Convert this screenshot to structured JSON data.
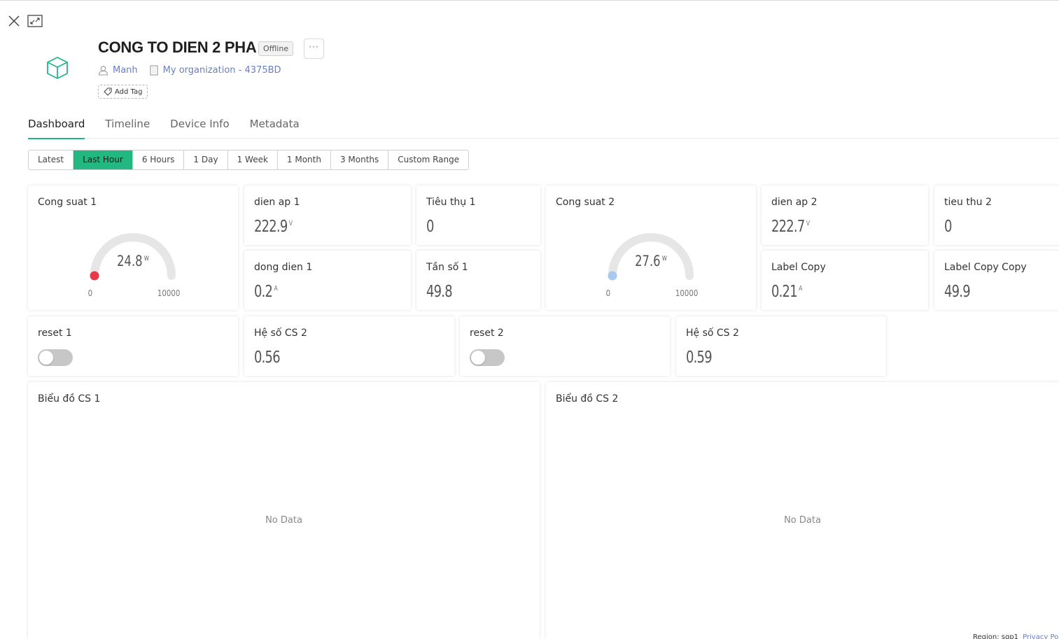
{
  "device": {
    "title": "CONG TO DIEN 2 PHA",
    "status": "Offline",
    "owner": "Manh",
    "organization": "My organization - 4375BD",
    "add_tag": "Add Tag",
    "more": "···"
  },
  "tabs": [
    {
      "label": "Dashboard",
      "active": true
    },
    {
      "label": "Timeline",
      "active": false
    },
    {
      "label": "Device Info",
      "active": false
    },
    {
      "label": "Metadata",
      "active": false
    }
  ],
  "time_ranges": [
    {
      "label": "Latest",
      "active": false
    },
    {
      "label": "Last Hour",
      "active": true
    },
    {
      "label": "6 Hours",
      "active": false
    },
    {
      "label": "1 Day",
      "active": false
    },
    {
      "label": "1 Week",
      "active": false
    },
    {
      "label": "1 Month",
      "active": false
    },
    {
      "label": "3 Months",
      "active": false
    },
    {
      "label": "Custom Range",
      "active": false
    }
  ],
  "widgets": {
    "gauge1": {
      "title": "Cong suat 1",
      "value": "24.8",
      "unit": "W",
      "min": "0",
      "max": "10000",
      "dot_color": "#e8394a"
    },
    "gauge2": {
      "title": "Cong suat 2",
      "value": "27.6",
      "unit": "W",
      "min": "0",
      "max": "10000",
      "dot_color": "#a9c8f0"
    },
    "dien_ap_1": {
      "title": "dien ap 1",
      "value": "222.9",
      "unit": "V"
    },
    "tieu_thu_1": {
      "title": "Tiêu thụ 1",
      "value": "0"
    },
    "dong_dien_1": {
      "title": "dong dien 1",
      "value": "0.2",
      "unit": "A"
    },
    "tan_so_1": {
      "title": "Tần số 1",
      "value": "49.8"
    },
    "dien_ap_2": {
      "title": "dien ap 2",
      "value": "222.7",
      "unit": "V"
    },
    "tieu_thu_2": {
      "title": "tieu thu 2",
      "value": "0"
    },
    "label_copy": {
      "title": "Label Copy",
      "value": "0.21",
      "unit": "A"
    },
    "label_copy_copy": {
      "title": "Label Copy Copy",
      "value": "49.9"
    },
    "reset1": {
      "title": "reset 1",
      "on": false
    },
    "he_so_cs_1": {
      "title": "Hệ số CS 2",
      "value": "0.56"
    },
    "reset2": {
      "title": "reset 2",
      "on": false
    },
    "he_so_cs_2": {
      "title": "Hệ số CS 2",
      "value": "0.59"
    },
    "chart1": {
      "title": "Biểu đồ CS 1",
      "empty_text": "No Data"
    },
    "chart2": {
      "title": "Biểu đồ CS 2",
      "empty_text": "No Data"
    }
  },
  "footer": {
    "region": "Region: sgp1",
    "privacy": "Privacy Policy"
  },
  "colors": {
    "accent": "#23b882",
    "link": "#6a7fc0"
  }
}
